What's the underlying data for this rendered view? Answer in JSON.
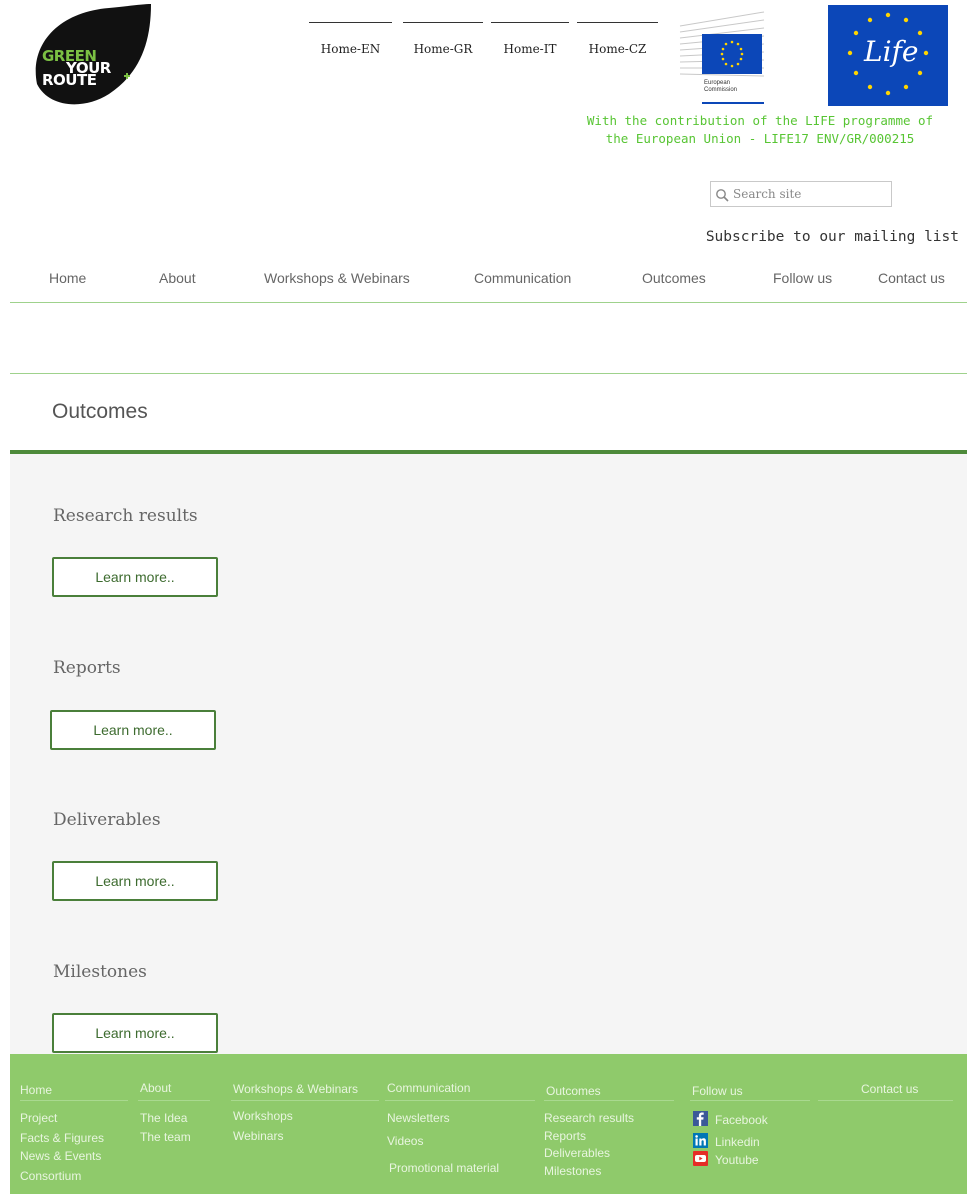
{
  "header": {
    "logo": {
      "line1": "GREEN",
      "line2": "YOUR",
      "line3": "ROUTE"
    },
    "languages": [
      {
        "label": "Home-EN"
      },
      {
        "label": "Home-GR"
      },
      {
        "label": "Home-IT"
      },
      {
        "label": "Home-CZ"
      }
    ],
    "ec_logo": {
      "line1": "European",
      "line2": "Commission"
    },
    "life_logo": {
      "text": "Life"
    },
    "contribution_line1": "With the contribution of the LIFE programme of",
    "contribution_line2": "the European Union - LIFE17 ENV/GR/000215",
    "search_placeholder": "Search site",
    "subscribe_label": "Subscribe to our mailing list"
  },
  "nav": [
    {
      "label": "Home"
    },
    {
      "label": "About"
    },
    {
      "label": "Workshops & Webinars"
    },
    {
      "label": "Communication"
    },
    {
      "label": "Outcomes"
    },
    {
      "label": "Follow us"
    },
    {
      "label": "Contact us"
    }
  ],
  "page_title": "Outcomes",
  "sections": [
    {
      "title": "Research results",
      "button": "Learn more.."
    },
    {
      "title": "Reports",
      "button": "Learn more.."
    },
    {
      "title": "Deliverables",
      "button": "Learn more.."
    },
    {
      "title": "Milestones",
      "button": "Learn more.."
    }
  ],
  "footer": {
    "columns": [
      {
        "heading": "Home",
        "links": [
          "Project",
          "Facts & Figures",
          "News & Events",
          "Consortium"
        ]
      },
      {
        "heading": "About",
        "links": [
          "The Idea",
          "The team"
        ]
      },
      {
        "heading": "Workshops & Webinars",
        "links": [
          "Workshops",
          "Webinars"
        ]
      },
      {
        "heading": "Communication",
        "links": [
          "Newsletters",
          "Videos",
          "Promotional material"
        ]
      },
      {
        "heading": "Outcomes",
        "links": [
          "Research results",
          "Reports",
          "Deliverables",
          "Milestones"
        ]
      },
      {
        "heading": "Follow us",
        "links": [
          "Facebook",
          "Linkedin",
          "Youtube"
        ]
      },
      {
        "heading": "Contact us",
        "links": []
      }
    ]
  },
  "colors": {
    "accent_green": "#4d8a3a",
    "footer_green": "#8fca6b",
    "contribution_green": "#58c534",
    "eu_blue": "#0c47b8"
  }
}
